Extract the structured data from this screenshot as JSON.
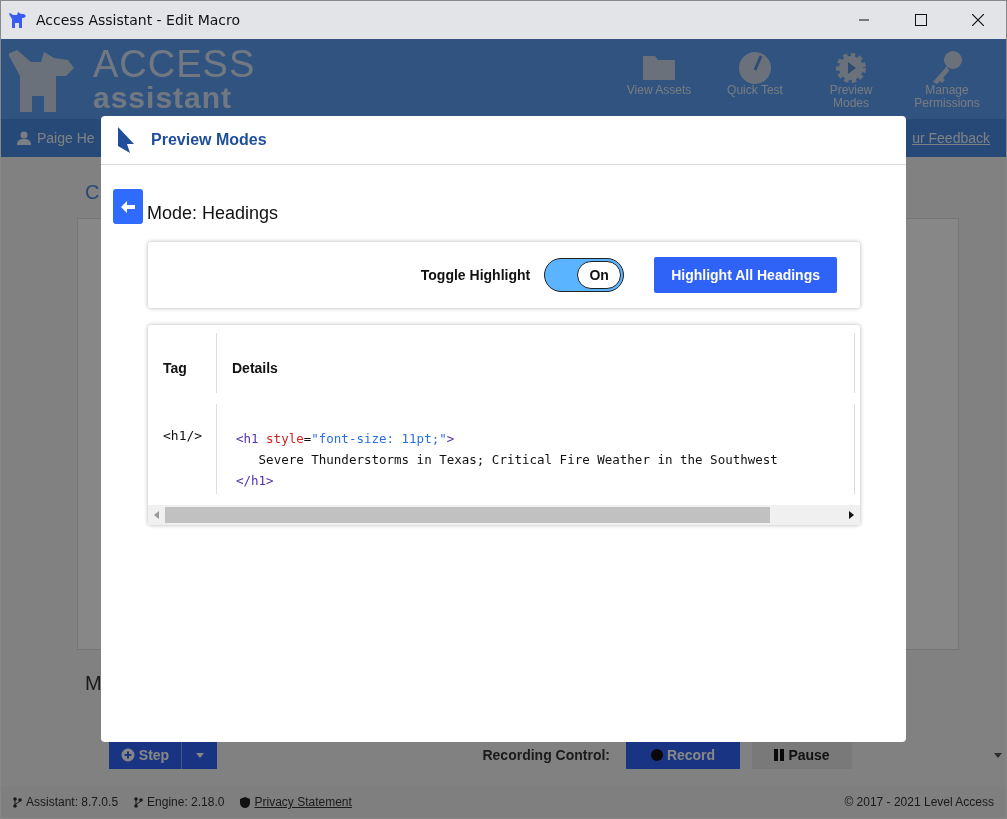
{
  "window": {
    "title": "Access Assistant - Edit Macro"
  },
  "app_header": {
    "logo": {
      "line_1": "ACCESS",
      "line_2": "assistant"
    },
    "tools": [
      {
        "label": "View Assets",
        "kind": "folder"
      },
      {
        "label": "Quick Test",
        "kind": "gauge"
      },
      {
        "label": "Preview Modes",
        "kind": "gear"
      },
      {
        "label": "Manage Permissions",
        "kind": "key"
      }
    ]
  },
  "user_bar": {
    "user": "Paige He",
    "feedback_link": "ur Feedback"
  },
  "background": {
    "heading_1": "C",
    "heading_2": "M",
    "step_button": "Step",
    "recording_label": "Recording Control:",
    "record_button": "Record",
    "pause_button": "Pause"
  },
  "footer": {
    "assistant_version": "Assistant: 8.7.0.5",
    "engine_version": "Engine: 2.18.0",
    "privacy_link": "Privacy Statement",
    "copyright": "© 2017 - 2021 Level Access"
  },
  "modal": {
    "title": "Preview Modes",
    "mode_title": "Mode: Headings",
    "toggle": {
      "label": "Toggle Highlight",
      "on": true,
      "text": "On"
    },
    "highlight_button": "Highlight All Headings",
    "table": {
      "columns": [
        "Tag",
        "Details"
      ],
      "rows": [
        {
          "tag": "<h1/>",
          "details": [
            [
              {
                "kind": "tag",
                "text": "<h1"
              },
              {
                "kind": "attr",
                "text": "style"
              },
              {
                "kind": "plain",
                "text": "="
              },
              {
                "kind": "string",
                "text": "\"font-size: 11pt;\""
              },
              {
                "kind": "tag",
                "text": ">"
              }
            ],
            [
              {
                "kind": "plain",
                "text": "   Severe Thunderstorms in Texas; Critical Fire Weather in the Southwest"
              }
            ],
            [
              {
                "kind": "tag",
                "text": "</h1>"
              }
            ]
          ]
        }
      ]
    }
  }
}
